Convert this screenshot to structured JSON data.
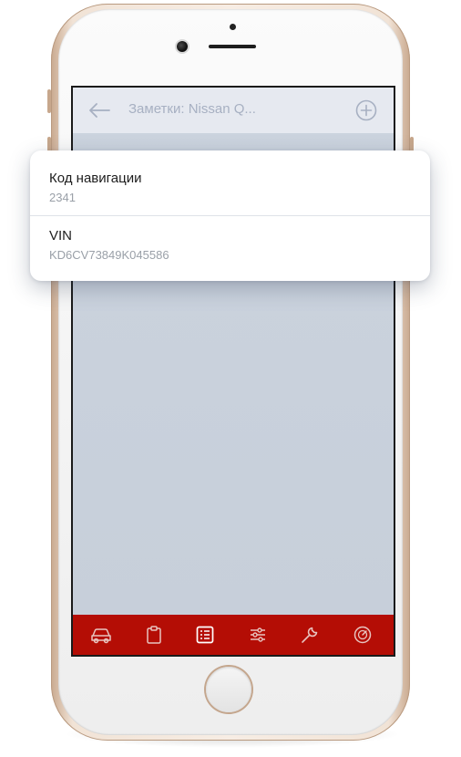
{
  "header": {
    "title": "Заметки: Nissan Q..."
  },
  "notes": [
    {
      "title": "Код навигации",
      "value": "2341"
    },
    {
      "title": "VIN",
      "value": "KD6CV73849K045586"
    }
  ],
  "tabbar": {
    "items": [
      {
        "icon": "car-icon"
      },
      {
        "icon": "clipboard-icon"
      },
      {
        "icon": "notes-list-icon",
        "active": true
      },
      {
        "icon": "settings-sliders-icon"
      },
      {
        "icon": "wrench-icon"
      },
      {
        "icon": "speedometer-icon"
      }
    ]
  },
  "colors": {
    "tabbar": "#b40d05",
    "header": "#e6e9f0",
    "screen": "#cdd4de",
    "header_text": "#a7b0c2",
    "phone_frame": "#f1e3d6"
  }
}
